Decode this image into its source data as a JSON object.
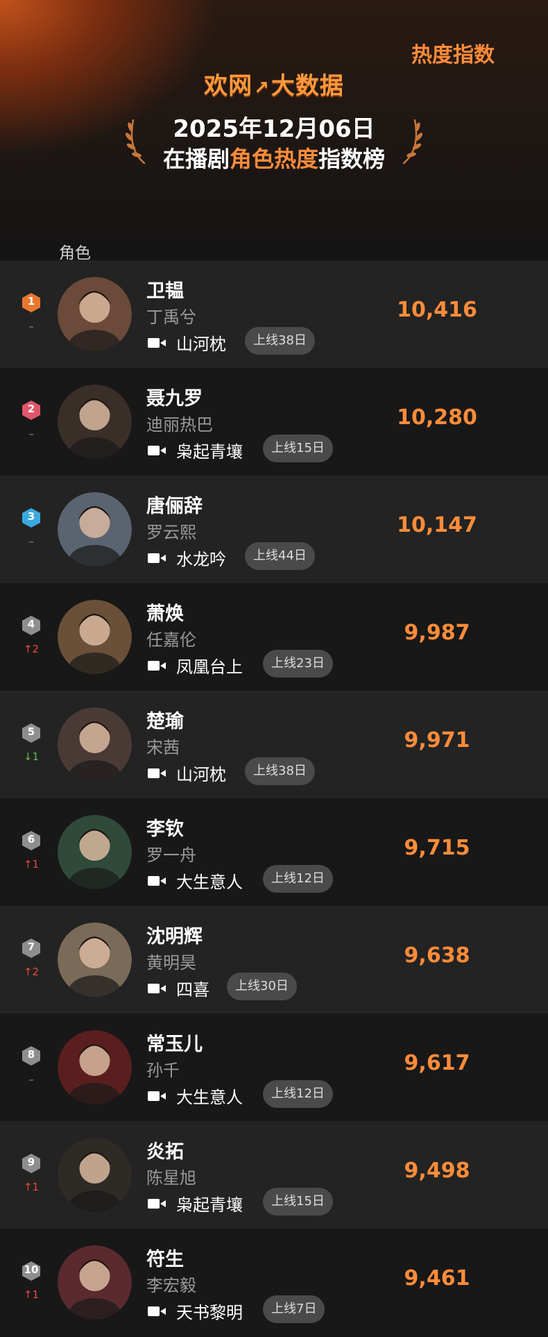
{
  "header": {
    "brand_left": "欢网",
    "brand_right": "大数据",
    "date": "2025年12月06日",
    "title_pre": "在播剧",
    "title_highlight": "角色热度",
    "title_post": "指数榜"
  },
  "columns": {
    "role": "角色",
    "heat": "热度指数"
  },
  "colors": {
    "accent": "#ff8c3a",
    "rank1": "#e8772e",
    "rank2": "#e0566a",
    "rank3": "#3aa9e0",
    "rank_other": "#8e8e8e",
    "up": "#e84a3a",
    "down": "#5fbf4a"
  },
  "rows": [
    {
      "rank": "1",
      "change": "–",
      "change_dir": "none",
      "character": "卫韫",
      "actor": "丁禹兮",
      "drama": "山河枕",
      "days": "上线38日",
      "heat": "10,416",
      "avatar_color": "#6b4a3a"
    },
    {
      "rank": "2",
      "change": "–",
      "change_dir": "none",
      "character": "聂九罗",
      "actor": "迪丽热巴",
      "drama": "枭起青壤",
      "days": "上线15日",
      "heat": "10,280",
      "avatar_color": "#3a2e28"
    },
    {
      "rank": "3",
      "change": "–",
      "change_dir": "none",
      "character": "唐俪辞",
      "actor": "罗云熙",
      "drama": "水龙吟",
      "days": "上线44日",
      "heat": "10,147",
      "avatar_color": "#5a6470"
    },
    {
      "rank": "4",
      "change": "2",
      "change_dir": "up",
      "character": "萧焕",
      "actor": "任嘉伦",
      "drama": "凤凰台上",
      "days": "上线23日",
      "heat": "9,987",
      "avatar_color": "#6a5038"
    },
    {
      "rank": "5",
      "change": "1",
      "change_dir": "down",
      "character": "楚瑜",
      "actor": "宋茜",
      "drama": "山河枕",
      "days": "上线38日",
      "heat": "9,971",
      "avatar_color": "#4a3a36"
    },
    {
      "rank": "6",
      "change": "1",
      "change_dir": "up",
      "character": "李钦",
      "actor": "罗一舟",
      "drama": "大生意人",
      "days": "上线12日",
      "heat": "9,715",
      "avatar_color": "#2f4a3a"
    },
    {
      "rank": "7",
      "change": "2",
      "change_dir": "up",
      "character": "沈明辉",
      "actor": "黄明昊",
      "drama": "四喜",
      "days": "上线30日",
      "heat": "9,638",
      "avatar_color": "#7a6a58"
    },
    {
      "rank": "8",
      "change": "–",
      "change_dir": "none",
      "character": "常玉儿",
      "actor": "孙千",
      "drama": "大生意人",
      "days": "上线12日",
      "heat": "9,617",
      "avatar_color": "#5a1e1e"
    },
    {
      "rank": "9",
      "change": "1",
      "change_dir": "up",
      "character": "炎拓",
      "actor": "陈星旭",
      "drama": "枭起青壤",
      "days": "上线15日",
      "heat": "9,498",
      "avatar_color": "#2e2a26"
    },
    {
      "rank": "10",
      "change": "1",
      "change_dir": "up",
      "character": "符生",
      "actor": "李宏毅",
      "drama": "天书黎明",
      "days": "上线7日",
      "heat": "9,461",
      "avatar_color": "#5a2a2e"
    }
  ]
}
